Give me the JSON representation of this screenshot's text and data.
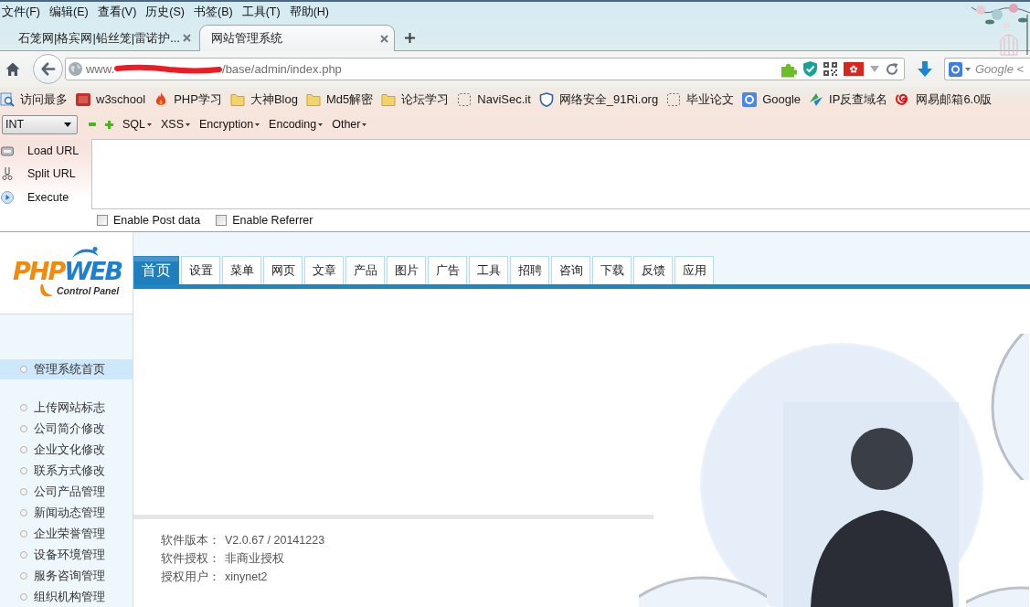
{
  "menu_bar": [
    "文件(F)",
    "编辑(E)",
    "查看(V)",
    "历史(S)",
    "书签(B)",
    "工具(T)",
    "帮助(H)"
  ],
  "browser_tabs": [
    {
      "title": "石笼网|格宾网|铅丝笼|雷诺护...",
      "selected": false
    },
    {
      "title": "网站管理系统",
      "selected": true
    }
  ],
  "address_bar": {
    "url_start": "www.",
    "url_end": "/base/admin/index.php"
  },
  "search": {
    "placeholder": "Google <"
  },
  "bookmarks": [
    {
      "label": "访问最多",
      "kind": "smart"
    },
    {
      "label": "w3school",
      "kind": "w3"
    },
    {
      "label": "PHP学习",
      "kind": "flame"
    },
    {
      "label": "大神Blog",
      "kind": "folder"
    },
    {
      "label": "Md5解密",
      "kind": "folder"
    },
    {
      "label": "论坛学习",
      "kind": "folder"
    },
    {
      "label": "NaviSec.it",
      "kind": "blank"
    },
    {
      "label": "网络安全_91Ri.org",
      "kind": "shield"
    },
    {
      "label": "毕业论文",
      "kind": "blank"
    },
    {
      "label": "Google",
      "kind": "google"
    },
    {
      "label": "IP反查域名",
      "kind": "ip"
    },
    {
      "label": "网易邮箱6.0版",
      "kind": "mail"
    }
  ],
  "hackbar": {
    "select": "INT",
    "menus": [
      "SQL",
      "XSS",
      "Encryption",
      "Encoding",
      "Other"
    ],
    "actions": [
      {
        "label": "Load URL",
        "kind": "load"
      },
      {
        "label": "Split URL",
        "kind": "split"
      },
      {
        "label": "Execute",
        "kind": "execute"
      }
    ],
    "options": [
      {
        "label": "Enable Post data",
        "checked": false
      },
      {
        "label": "Enable Referrer",
        "checked": false
      }
    ]
  },
  "site": {
    "logo": {
      "parts": [
        {
          "text": "PHP",
          "color": "#f28a0c"
        },
        {
          "text": "WEB",
          "color": "#1f7fcf"
        }
      ],
      "subtitle": "Control Panel"
    },
    "sidebar": {
      "groups": [
        {
          "items": [
            {
              "label": "管理系统首页",
              "selected": true
            }
          ]
        },
        {
          "items": [
            {
              "label": "上传网站标志",
              "selected": false
            },
            {
              "label": "公司简介修改",
              "selected": false
            },
            {
              "label": "企业文化修改",
              "selected": false
            },
            {
              "label": "联系方式修改",
              "selected": false
            },
            {
              "label": "公司产品管理",
              "selected": false
            },
            {
              "label": "新闻动态管理",
              "selected": false
            },
            {
              "label": "企业荣誉管理",
              "selected": false
            },
            {
              "label": "设备环境管理",
              "selected": false
            },
            {
              "label": "服务咨询管理",
              "selected": false
            },
            {
              "label": "组织机构管理",
              "selected": false
            }
          ]
        }
      ]
    },
    "tabs": [
      {
        "label": "首页",
        "selected": true
      },
      {
        "label": "设置",
        "selected": false
      },
      {
        "label": "菜单",
        "selected": false
      },
      {
        "label": "网页",
        "selected": false
      },
      {
        "label": "文章",
        "selected": false
      },
      {
        "label": "产品",
        "selected": false
      },
      {
        "label": "图片",
        "selected": false
      },
      {
        "label": "广告",
        "selected": false
      },
      {
        "label": "工具",
        "selected": false
      },
      {
        "label": "招聘",
        "selected": false
      },
      {
        "label": "咨询",
        "selected": false
      },
      {
        "label": "下载",
        "selected": false
      },
      {
        "label": "反馈",
        "selected": false
      },
      {
        "label": "应用",
        "selected": false
      }
    ],
    "info": [
      {
        "label": "软件版本：",
        "value": "V2.0.67 / 20141223"
      },
      {
        "label": "软件授权：",
        "value": "非商业授权"
      },
      {
        "label": "授权用户：",
        "value": "xinynet2"
      }
    ]
  }
}
